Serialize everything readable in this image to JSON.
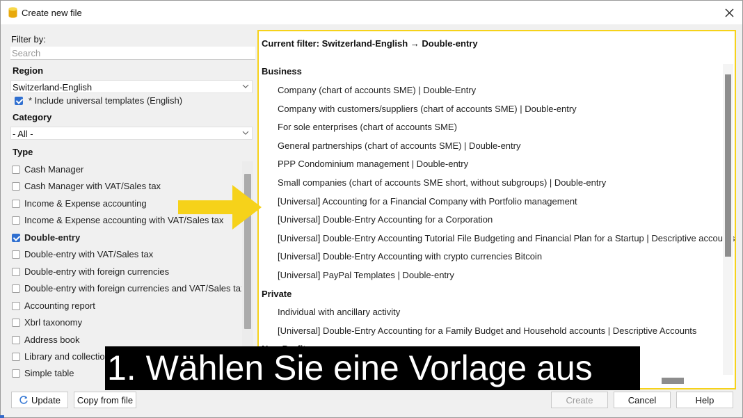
{
  "window": {
    "title": "Create new file"
  },
  "icons": {
    "app": "database-icon",
    "close": "close-icon",
    "refresh": "refresh-icon",
    "arrow": "yellow-arrow-icon",
    "chevron": "chevron-down-icon"
  },
  "colors": {
    "highlight_border": "#f6d21a",
    "arrow": "#f6d21a",
    "checkbox_on": "#2f6fd0",
    "caption_bg": "#000000"
  },
  "filter": {
    "label": "Filter by:",
    "search_placeholder": "Search",
    "region_label": "Region",
    "region_value": "Switzerland-English",
    "universal_label": "* Include universal templates (English)",
    "universal_checked": true,
    "category_label": "Category",
    "category_value": "- All -",
    "type_label": "Type",
    "types": [
      {
        "label": "Cash Manager",
        "checked": false
      },
      {
        "label": "Cash Manager with VAT/Sales tax",
        "checked": false
      },
      {
        "label": "Income & Expense accounting",
        "checked": false
      },
      {
        "label": "Income & Expense accounting with VAT/Sales tax",
        "checked": false
      },
      {
        "label": "Double-entry",
        "checked": true
      },
      {
        "label": "Double-entry with VAT/Sales tax",
        "checked": false
      },
      {
        "label": "Double-entry with foreign currencies",
        "checked": false
      },
      {
        "label": "Double-entry with foreign currencies and VAT/Sales tax",
        "checked": false
      },
      {
        "label": "Accounting report",
        "checked": false
      },
      {
        "label": "Xbrl taxonomy",
        "checked": false
      },
      {
        "label": "Address book",
        "checked": false
      },
      {
        "label": "Library and collections",
        "checked": false
      },
      {
        "label": "Simple table",
        "checked": false
      }
    ]
  },
  "templates": {
    "current_filter": "Current filter: Switzerland-English → Double-entry",
    "groups": [
      {
        "name": "Business",
        "items": [
          "Company (chart of accounts SME) | Double-Entry",
          "Company with customers/suppliers (chart of accounts SME) | Double-entry",
          "For sole enterprises (chart of accounts SME)",
          "General partnerships (chart of accounts SME) | Double-entry",
          "PPP Condominium management | Double-entry",
          "Small companies (chart of accounts SME short, without subgroups) | Double-entry",
          "[Universal] Accounting for a Financial Company with Portfolio management",
          "[Universal] Double-Entry Accounting for a Corporation",
          "[Universal] Double-Entry Accounting Tutorial File Budgeting and Financial Plan for a Startup | Descriptive accounts",
          "[Universal] Double-Entry Accounting with crypto currencies Bitcoin",
          "[Universal] PayPal Templates | Double-entry"
        ]
      },
      {
        "name": "Private",
        "items": [
          "Individual with ancillary activity",
          "[Universal] Double-Entry Accounting for a Family Budget and Household accounts | Descriptive Accounts"
        ]
      },
      {
        "name": "Non-Profit",
        "items": []
      }
    ]
  },
  "caption": "1. Wählen Sie eine Vorlage aus",
  "buttons": {
    "update": "Update",
    "copy_from_file": "Copy from file",
    "create": "Create",
    "cancel": "Cancel",
    "help": "Help"
  }
}
